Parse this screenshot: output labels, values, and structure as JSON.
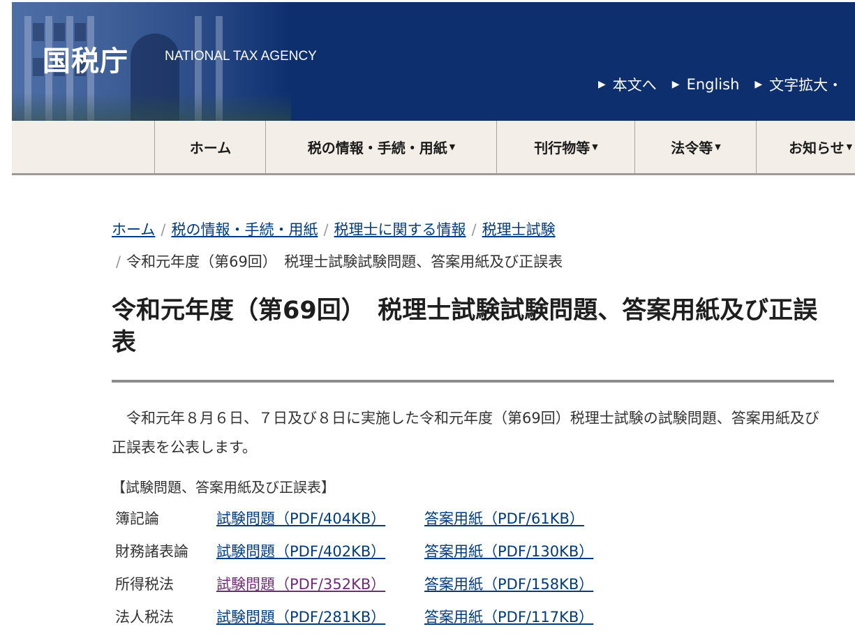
{
  "header": {
    "logo_ja": "国税庁",
    "logo_en": "NATIONAL TAX AGENCY",
    "utility_links": [
      "本文へ",
      "English",
      "文字拡大・"
    ]
  },
  "nav": {
    "items": [
      {
        "label": "ホーム",
        "dropdown": false
      },
      {
        "label": "税の情報・手続・用紙",
        "dropdown": true
      },
      {
        "label": "刊行物等",
        "dropdown": true
      },
      {
        "label": "法令等",
        "dropdown": true
      },
      {
        "label": "お知らせ",
        "dropdown": true
      }
    ]
  },
  "breadcrumb": {
    "links": [
      "ホーム",
      "税の情報・手続・用紙",
      "税理士に関する情報",
      "税理士試験"
    ],
    "current": "令和元年度（第69回）　税理士試験試験問題、答案用紙及び正誤表"
  },
  "page": {
    "title": "令和元年度（第69回）　税理士試験試験問題、答案用紙及び正誤表",
    "intro": "令和元年８月６日、７日及び８日に実施した令和元年度（第69回）税理士試験の試験問題、答案用紙及び正誤表を公表します。",
    "files_heading": "【試験問題、答案用紙及び正誤表】",
    "files": [
      {
        "subject": "簿記論",
        "exam": "試験問題（PDF/404KB）",
        "answer": "答案用紙（PDF/61KB）"
      },
      {
        "subject": "財務諸表論",
        "exam": "試験問題（PDF/402KB）",
        "answer": "答案用紙（PDF/130KB）"
      },
      {
        "subject": "所得税法",
        "exam": "試験問題（PDF/352KB）",
        "answer": "答案用紙（PDF/158KB）"
      },
      {
        "subject": "法人税法",
        "exam": "試験問題（PDF/281KB）",
        "answer": "答案用紙（PDF/117KB）"
      }
    ]
  },
  "colors": {
    "header_bg": "#0d2f6e",
    "nav_bg": "#f3efe8",
    "link": "#003b7d",
    "visited_link": "#702a77"
  }
}
